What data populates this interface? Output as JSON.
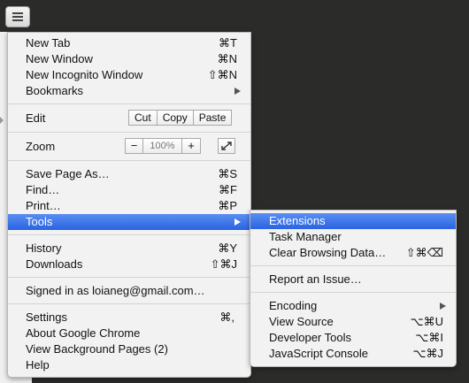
{
  "menu": {
    "items": [
      {
        "label": "New Tab",
        "shortcut": "⌘T"
      },
      {
        "label": "New Window",
        "shortcut": "⌘N"
      },
      {
        "label": "New Incognito Window",
        "shortcut": "⇧⌘N"
      },
      {
        "label": "Bookmarks",
        "shortcut": ""
      }
    ],
    "edit": {
      "label": "Edit",
      "cut": "Cut",
      "copy": "Copy",
      "paste": "Paste"
    },
    "zoom": {
      "label": "Zoom",
      "minus": "−",
      "value": "100%",
      "plus": "+"
    },
    "page": [
      {
        "label": "Save Page As…",
        "shortcut": "⌘S"
      },
      {
        "label": "Find…",
        "shortcut": "⌘F"
      },
      {
        "label": "Print…",
        "shortcut": "⌘P"
      },
      {
        "label": "Tools",
        "shortcut": ""
      }
    ],
    "history": [
      {
        "label": "History",
        "shortcut": "⌘Y"
      },
      {
        "label": "Downloads",
        "shortcut": "⇧⌘J"
      }
    ],
    "signed_in": "Signed in as loianeg@gmail.com…",
    "bottom": [
      {
        "label": "Settings",
        "shortcut": "⌘,"
      },
      {
        "label": "About Google Chrome",
        "shortcut": ""
      },
      {
        "label": "View Background Pages (2)",
        "shortcut": ""
      },
      {
        "label": "Help",
        "shortcut": ""
      }
    ]
  },
  "tools_submenu": {
    "items": [
      {
        "label": "Extensions",
        "shortcut": ""
      },
      {
        "label": "Task Manager",
        "shortcut": ""
      },
      {
        "label": "Clear Browsing Data…",
        "shortcut": "⇧⌘⌫"
      },
      {
        "label": "Report an Issue…",
        "shortcut": ""
      },
      {
        "label": "Encoding",
        "shortcut": ""
      },
      {
        "label": "View Source",
        "shortcut": "⌥⌘U"
      },
      {
        "label": "Developer Tools",
        "shortcut": "⌥⌘I"
      },
      {
        "label": "JavaScript Console",
        "shortcut": "⌥⌘J"
      }
    ]
  },
  "colors": {
    "highlight": "#2a63e2",
    "menu_bg": "#f2f2f2",
    "page_bg": "#2b2b29"
  }
}
